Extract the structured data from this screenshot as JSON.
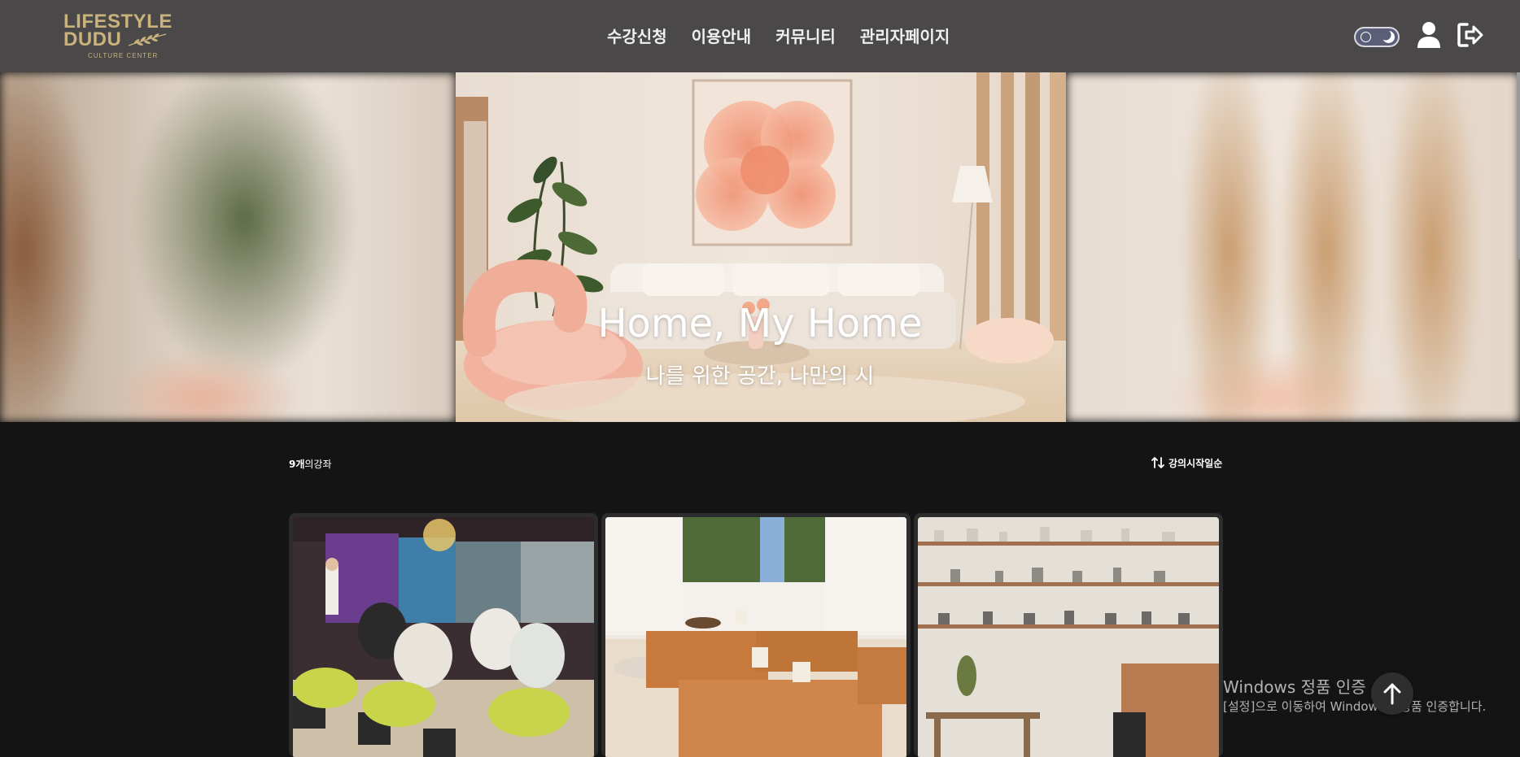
{
  "logo": {
    "line1": "LIFESTYLE",
    "line2": "DUDU",
    "sub": "CULTURE CENTER",
    "color": "#c9b27c"
  },
  "nav": {
    "items": [
      "수강신청",
      "이용안내",
      "커뮤니티",
      "관리자페이지"
    ]
  },
  "header_icons": {
    "theme_toggle": "sun-moon-toggle-icon",
    "user": "user-icon",
    "logout": "logout-icon"
  },
  "hero": {
    "title": "Home, My Home",
    "subtitle": "나를 위한 공간, 나만의 시"
  },
  "list": {
    "count": "9개",
    "count_suffix": "의강좌",
    "sort_label": "강의시작일순",
    "sort_icon": "sort-arrows-icon"
  },
  "cards": [
    {
      "image": "wine-class-photo"
    },
    {
      "image": "tea-room-photo"
    },
    {
      "image": "ceramics-shelf-photo"
    }
  ],
  "watermark": {
    "title": "Windows 정품 인증",
    "text": "[설정]으로 이동하여 Windows를 정품 인증합니다."
  },
  "colors": {
    "header_bg": "#4a4849",
    "page_bg": "#141414",
    "card_bg": "#2c2c2c"
  }
}
